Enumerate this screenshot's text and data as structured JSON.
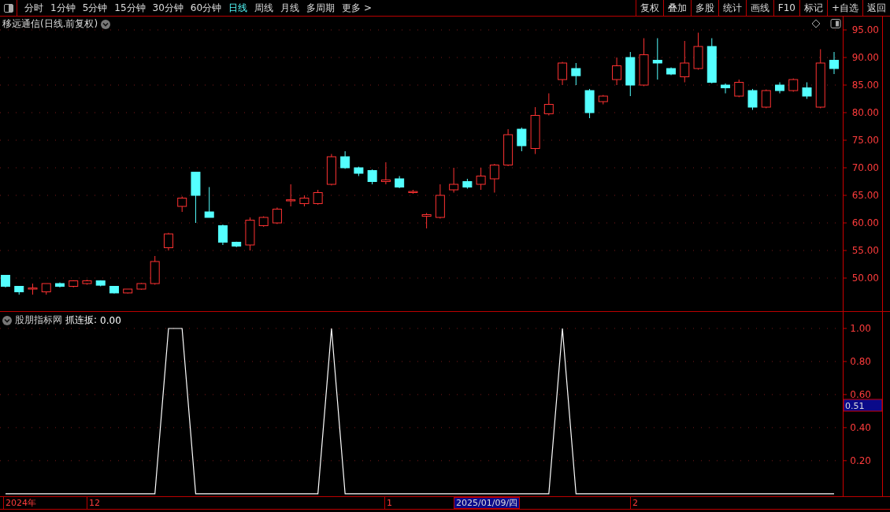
{
  "toolbar": {
    "periods": [
      {
        "label": "分时",
        "selected": false
      },
      {
        "label": "1分钟",
        "selected": false
      },
      {
        "label": "5分钟",
        "selected": false
      },
      {
        "label": "15分钟",
        "selected": false
      },
      {
        "label": "30分钟",
        "selected": false
      },
      {
        "label": "60分钟",
        "selected": false
      },
      {
        "label": "日线",
        "selected": true
      },
      {
        "label": "周线",
        "selected": false
      },
      {
        "label": "月线",
        "selected": false
      },
      {
        "label": "多周期",
        "selected": false
      },
      {
        "label": "更多 >",
        "selected": false
      }
    ],
    "actions": [
      "复权",
      "叠加",
      "多股",
      "统计",
      "画线",
      "F10",
      "标记",
      "+自选",
      "返回"
    ]
  },
  "price_panel": {
    "title": "移远通信(日线.前复权)",
    "chart_data": {
      "type": "candlestick",
      "grid": true,
      "ylim": [
        44,
        97.43
      ],
      "yticks": [
        {
          "value": 95,
          "label": "95.00"
        },
        {
          "value": 90,
          "label": "90.00"
        },
        {
          "value": 85,
          "label": "85.00"
        },
        {
          "value": 80,
          "label": "80.00"
        },
        {
          "value": 75,
          "label": "75.00"
        },
        {
          "value": 70,
          "label": "70.00"
        },
        {
          "value": 65,
          "label": "65.00"
        },
        {
          "value": 60,
          "label": "60.00"
        },
        {
          "value": 55,
          "label": "55.00"
        },
        {
          "value": 50,
          "label": "50.00"
        }
      ],
      "ohlc": [
        [
          50.5,
          50.5,
          48.3,
          48.5
        ],
        [
          48.5,
          48.5,
          47,
          47.5
        ],
        [
          48,
          49,
          47,
          48.2
        ],
        [
          47.5,
          49,
          47,
          49
        ],
        [
          49,
          49.2,
          48.3,
          48.5
        ],
        [
          48.5,
          49.6,
          48.3,
          49.5
        ],
        [
          49,
          49.7,
          48.8,
          49.5
        ],
        [
          49.5,
          49.6,
          48.5,
          48.7
        ],
        [
          48.5,
          48.5,
          47.2,
          47.3
        ],
        [
          47.3,
          48,
          47.2,
          48
        ],
        [
          48,
          49.1,
          47.9,
          49
        ],
        [
          49,
          54,
          48.8,
          53
        ],
        [
          55.5,
          58.2,
          55,
          58
        ],
        [
          63,
          64.8,
          62,
          64.5
        ],
        [
          69.2,
          69.2,
          60,
          65
        ],
        [
          62,
          66.5,
          61,
          61
        ],
        [
          59.5,
          59.7,
          56,
          56.5
        ],
        [
          56.5,
          56.6,
          55.6,
          55.8
        ],
        [
          56,
          61,
          55,
          60.5
        ],
        [
          59.5,
          61.2,
          59.3,
          61
        ],
        [
          60,
          62.8,
          59.8,
          62.5
        ],
        [
          64,
          67,
          63,
          64.2
        ],
        [
          63.5,
          65,
          63,
          64.5
        ],
        [
          63.5,
          66,
          63.3,
          65.5
        ],
        [
          67,
          72.5,
          66.8,
          72
        ],
        [
          72,
          73,
          69.8,
          70
        ],
        [
          70,
          70.2,
          68.5,
          69
        ],
        [
          69.5,
          69.7,
          67,
          67.5
        ],
        [
          67.5,
          71,
          67,
          67.8
        ],
        [
          68,
          68.5,
          66.3,
          66.5
        ],
        [
          65.5,
          66,
          65.3,
          65.7
        ],
        [
          61.2,
          61.8,
          59,
          61.5
        ],
        [
          61,
          67,
          60.8,
          65
        ],
        [
          66,
          70,
          65.5,
          67
        ],
        [
          67.5,
          68,
          66.2,
          66.5
        ],
        [
          67,
          70,
          66,
          68.5
        ],
        [
          68,
          70.7,
          65.5,
          70.5
        ],
        [
          70.5,
          77,
          70.3,
          76
        ],
        [
          77,
          77.3,
          73,
          74
        ],
        [
          73.5,
          81,
          72.5,
          79.5
        ],
        [
          79.8,
          83.5,
          79.5,
          81.5
        ],
        [
          86,
          89.2,
          85,
          89
        ],
        [
          88,
          89,
          85,
          86.7
        ],
        [
          84,
          84.3,
          79,
          80
        ],
        [
          82,
          83.2,
          81.5,
          83
        ],
        [
          86,
          90,
          85,
          88.5
        ],
        [
          90,
          91,
          83,
          85
        ],
        [
          85,
          93.5,
          84.8,
          90.5
        ],
        [
          89.5,
          93.5,
          86,
          89
        ],
        [
          88,
          88.2,
          86.8,
          87
        ],
        [
          86.5,
          93,
          85.5,
          89
        ],
        [
          88,
          94.5,
          87.8,
          92
        ],
        [
          92,
          93.5,
          85.3,
          85.5
        ],
        [
          85,
          85.3,
          83.5,
          84.5
        ],
        [
          83,
          86,
          82.8,
          85.5
        ],
        [
          84,
          84.3,
          80.5,
          81
        ],
        [
          81,
          84.2,
          80.8,
          84
        ],
        [
          85,
          85.5,
          83.5,
          84
        ],
        [
          84,
          86.2,
          83.8,
          86
        ],
        [
          84.5,
          85.5,
          82.5,
          83
        ],
        [
          81,
          91.5,
          80.8,
          89
        ],
        [
          89.5,
          91,
          87,
          88
        ]
      ]
    }
  },
  "indicator_panel": {
    "source": "股朋指标网",
    "separator": ":",
    "reading": "0.00",
    "cursor_value": "0.51",
    "chart_data": {
      "type": "line",
      "grid": true,
      "ylim": [
        -0.02,
        1.1
      ],
      "yticks": [
        {
          "value": 1,
          "label": "1.00"
        },
        {
          "value": 0.8,
          "label": "0.80"
        },
        {
          "value": 0.6,
          "label": "0.60"
        },
        {
          "value": 0.4,
          "label": "0.40"
        },
        {
          "value": 0.2,
          "label": "0.20"
        }
      ],
      "series": [
        {
          "name": "抓连扳",
          "color": "#ffffff",
          "values": [
            0,
            0,
            0,
            0,
            0,
            0,
            0,
            0,
            0,
            0,
            0,
            0,
            1,
            1,
            0,
            0,
            0,
            0,
            0,
            0,
            0,
            0,
            0,
            0,
            1,
            0,
            0,
            0,
            0,
            0,
            0,
            0,
            0,
            0,
            0,
            0,
            0,
            0,
            0,
            0,
            0,
            1,
            0,
            0,
            0,
            0,
            0,
            0,
            0,
            0,
            0,
            0,
            0,
            0,
            0,
            0,
            0,
            0,
            0,
            0,
            0,
            0
          ]
        }
      ]
    }
  },
  "date_axis": [
    {
      "label": "2024年",
      "selected": false
    },
    {
      "label": "12",
      "selected": false
    },
    {
      "label": "1",
      "selected": false
    },
    {
      "label": "2025/01/09/四",
      "selected": true
    },
    {
      "label": "2",
      "selected": false
    }
  ]
}
